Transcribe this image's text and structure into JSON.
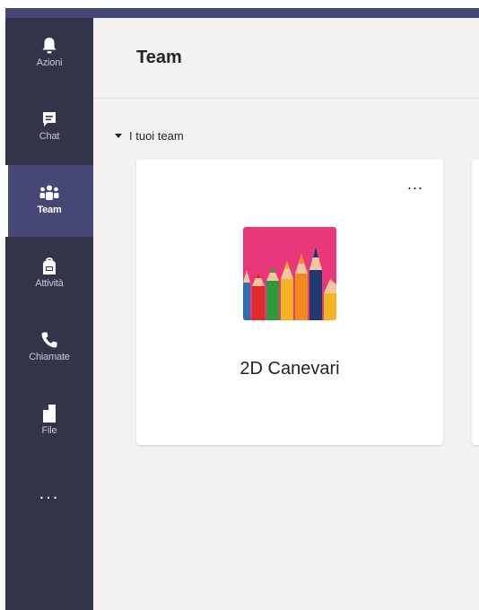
{
  "rail": {
    "items": [
      {
        "label": "Azioni",
        "icon": "bell-icon"
      },
      {
        "label": "Chat",
        "icon": "chat-icon"
      },
      {
        "label": "Team",
        "icon": "team-icon",
        "active": true
      },
      {
        "label": "Attività",
        "icon": "backpack-icon"
      },
      {
        "label": "Chiamate",
        "icon": "phone-icon"
      },
      {
        "label": "File",
        "icon": "file-icon"
      }
    ],
    "more_label": "..."
  },
  "header": {
    "title": "Team"
  },
  "section": {
    "label": "I tuoi team"
  },
  "teams": [
    {
      "name": "2D Canevari",
      "more_label": "..."
    }
  ],
  "colors": {
    "rail_bg": "#33344a",
    "rail_active": "#464775",
    "brand": "#464775",
    "main_bg": "#f3f2f1",
    "tile_bg": "#e8387a"
  }
}
